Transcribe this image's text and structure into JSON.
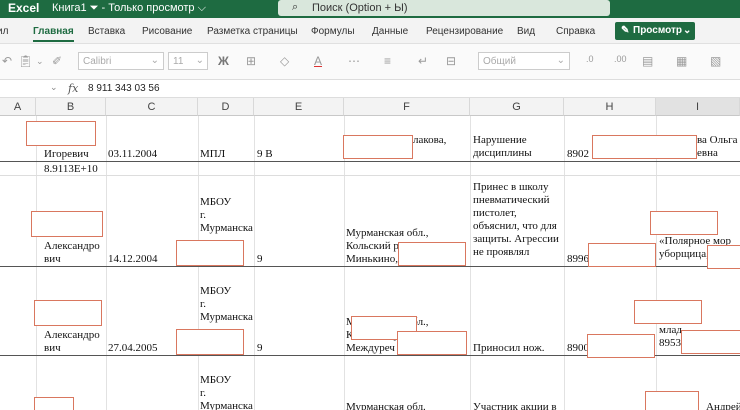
{
  "titlebar": {
    "app": "Excel",
    "book": "Книга1 ⏷ - Только просмотр ⌵",
    "book_text": "Книга1",
    "mode": "Только просмотр",
    "search_placeholder": "Поиск (Option + Ы)"
  },
  "tabs": [
    "Главная",
    "Вставка",
    "Рисование",
    "Разметка страницы",
    "Формулы",
    "Данные",
    "Рецензирование",
    "Вид",
    "Справка"
  ],
  "tabs_left_fragment": "ил",
  "view_button": "Просмотр",
  "toolbar": {
    "font_name": "Calibri",
    "font_size": "11",
    "bold": "Ж",
    "format": "Общий"
  },
  "formula_bar": {
    "fx": "fx",
    "value": "8 911 343 03 56"
  },
  "columns": [
    "A",
    "B",
    "C",
    "D",
    "E",
    "F",
    "G",
    "H",
    "I"
  ],
  "cells": {
    "r1_b": "Игоревич",
    "r1_c": "03.11.2004",
    "r1_d": "МПЛ",
    "r1_e": "9 В",
    "r1_f": "лакова,",
    "r1_g": "Нарушение\nдисциплины",
    "r1_h": "8902",
    "r1_i": "ва Ольга\nевна",
    "r2_b": "8.9113E+10",
    "r3_b": "Александро\nвич",
    "r3_c": "14.12.2004",
    "r3_d": "МБОУ\nг.\nМурманска",
    "r3_e": "9",
    "r3_f": "Мурманская обл.,\nКольский р\nМинькино,",
    "r3_g": "Принес в школу\nпневматический\nпистолет,\nобъяснил, что для\nзащиты. Агрессии\nне проявлял",
    "r3_h": "8996",
    "r3_i": "ежда\nна, С\n«Полярное мор\nуборщица, 8996",
    "r4_b": "Александро\nвич",
    "r4_c": "27.04.2005",
    "r4_d": "МБОУ\nг.\nМурманска",
    "r4_e": "9",
    "r4_f": "Мурманская обл.,\nКольский р\nМеждуреч",
    "r4_g": "Приносил нож.",
    "r4_h": "8900",
    "r4_i": "Надежд\nа, МБДО\nмлад\n8953",
    "r5_d": "МБОУ\nг.\nМурманска",
    "r5_f": "Мурманская обл.",
    "r5_g": "Участник акции в",
    "r5_i": "Андрей"
  },
  "colors": {
    "excel_green": "#1e6b41",
    "redaction_border": "#d9775f"
  }
}
